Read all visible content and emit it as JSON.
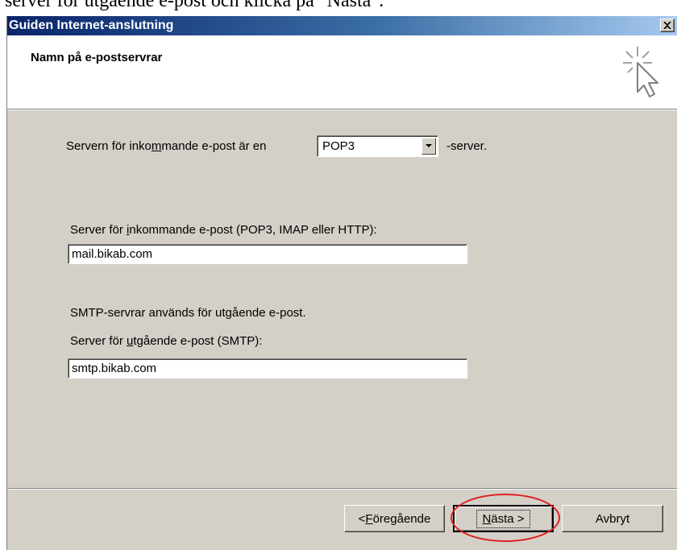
{
  "caption": "server för utgående e-post och klicka på \"Nästa\".",
  "window": {
    "title": "Guiden Internet-anslutning"
  },
  "header": {
    "heading": "Namn på e-postservrar",
    "icon": "wizard-cursor-icon"
  },
  "server_type": {
    "label_before": "Servern för inkommande e-post är en",
    "label_before_pre": "Servern för inko",
    "label_before_ul": "m",
    "label_before_post": "mande e-post är en",
    "selected": "POP3",
    "label_after": "-server."
  },
  "incoming": {
    "label_pre": "Server för ",
    "label_ul": "i",
    "label_post": "nkommande e-post (POP3, IMAP eller HTTP):",
    "value": "mail.bikab.com"
  },
  "smtp_info": "SMTP-servrar används för utgående e-post.",
  "outgoing": {
    "label_pre": "Server för ",
    "label_ul": "u",
    "label_post": "tgående e-post (SMTP):",
    "value": "smtp.bikab.com"
  },
  "buttons": {
    "back_pre": "< ",
    "back_ul": "F",
    "back_post": "öregående",
    "next_ul": "N",
    "next_post": "ästa >",
    "cancel": "Avbryt"
  },
  "colors": {
    "title_bar_start": "#0a246a",
    "title_bar_end": "#a6caf0",
    "dialog_face": "#d4d0c8",
    "highlight_ellipse": "#e02020"
  }
}
